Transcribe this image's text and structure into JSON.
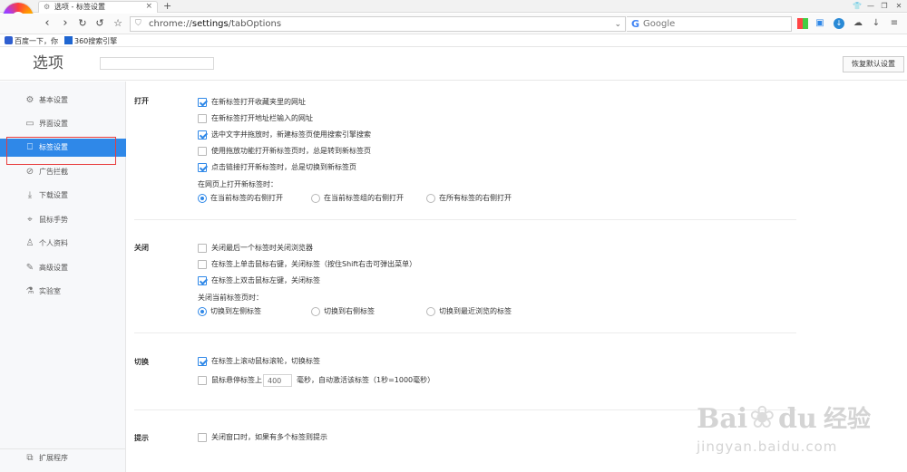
{
  "tab": {
    "title": "选项 - 标签设置"
  },
  "address": {
    "url_prefix": "chrome://",
    "url_host": "settings",
    "url_path": "/tabOptions"
  },
  "search": {
    "placeholder": "Google"
  },
  "bookmarks": [
    {
      "label": "百度一下，你"
    },
    {
      "label": "360搜索引擎"
    }
  ],
  "header": {
    "title": "选项",
    "reset_label": "恢复默认设置"
  },
  "sidebar": {
    "items": [
      {
        "label": "基本设置",
        "icon": "gear-icon"
      },
      {
        "label": "界面设置",
        "icon": "window-icon"
      },
      {
        "label": "标签设置",
        "icon": "tab-icon",
        "active": true
      },
      {
        "label": "广告拦截",
        "icon": "block-icon"
      },
      {
        "label": "下载设置",
        "icon": "download-icon"
      },
      {
        "label": "鼠标手势",
        "icon": "mouse-icon"
      },
      {
        "label": "个人资料",
        "icon": "user-icon"
      },
      {
        "label": "高级设置",
        "icon": "wrench-icon"
      },
      {
        "label": "实验室",
        "icon": "flask-icon"
      }
    ],
    "extensions_label": "扩展程序"
  },
  "sections": {
    "open": {
      "title": "打开",
      "options": [
        {
          "label": "在新标签打开收藏夹里的网址",
          "checked": true
        },
        {
          "label": "在新标签打开地址栏输入的网址",
          "checked": false
        },
        {
          "label": "选中文字并拖放时，新建标签页使用搜索引擎搜索",
          "checked": true
        },
        {
          "label": "使用拖放功能打开新标签页时，总是转到新标签页",
          "checked": false
        },
        {
          "label": "点击链接打开新标签时，总是切换到新标签页",
          "checked": true
        }
      ],
      "radio_label": "在网页上打开新标签时：",
      "radios": [
        {
          "label": "在当前标签的右侧打开",
          "selected": true
        },
        {
          "label": "在当前标签组的右侧打开",
          "selected": false
        },
        {
          "label": "在所有标签的右侧打开",
          "selected": false
        }
      ]
    },
    "close": {
      "title": "关闭",
      "options": [
        {
          "label": "关闭最后一个标签时关闭浏览器",
          "checked": false
        },
        {
          "label": "在标签上单击鼠标右键，关闭标签（按住Shift右击可弹出菜单）",
          "checked": false
        },
        {
          "label": "在标签上双击鼠标左键，关闭标签",
          "checked": true
        }
      ],
      "radio_label": "关闭当前标签页时：",
      "radios": [
        {
          "label": "切换到左侧标签",
          "selected": true
        },
        {
          "label": "切换到右侧标签",
          "selected": false
        },
        {
          "label": "切换到最近浏览的标签",
          "selected": false
        }
      ]
    },
    "switch": {
      "title": "切换",
      "options": [
        {
          "label": "在标签上滚动鼠标滚轮，切换标签",
          "checked": true
        },
        {
          "label": "鼠标悬停标签上",
          "checked": false
        }
      ],
      "delay_value": "400",
      "delay_suffix": "毫秒，自动激活该标签（1秒=1000毫秒）"
    },
    "hint": {
      "title": "提示",
      "options": [
        {
          "label": "关闭窗口时，如果有多个标签则提示",
          "checked": false
        }
      ]
    }
  },
  "watermark": {
    "bai": "Bai",
    "du": "du",
    "jingyan": "经验",
    "url": "jingyan.baidu.com"
  }
}
